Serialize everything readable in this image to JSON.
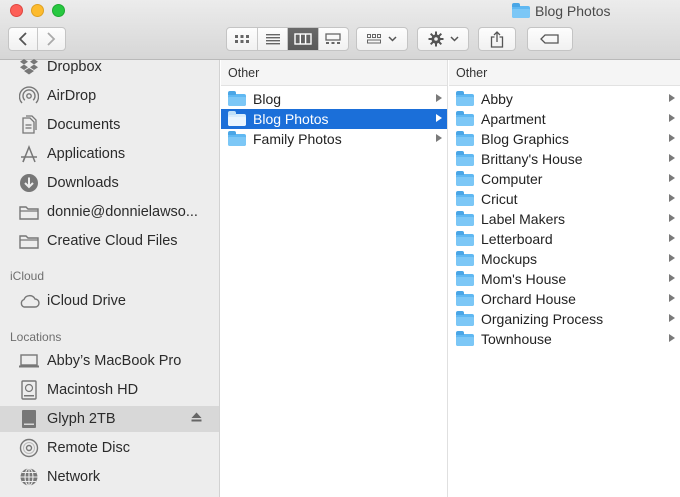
{
  "window": {
    "title": "Blog Photos"
  },
  "sidebar": {
    "items": [
      {
        "label": "Dropbox",
        "icon": "dropbox-icon"
      },
      {
        "label": "AirDrop",
        "icon": "airdrop-icon"
      },
      {
        "label": "Documents",
        "icon": "documents-icon"
      },
      {
        "label": "Applications",
        "icon": "applications-icon"
      },
      {
        "label": "Downloads",
        "icon": "downloads-icon"
      },
      {
        "label": "donnie@donnielawso...",
        "icon": "folder-icon"
      },
      {
        "label": "Creative Cloud Files",
        "icon": "folder-icon"
      }
    ],
    "icloud_header": "iCloud",
    "icloud_items": [
      {
        "label": "iCloud Drive",
        "icon": "cloud-icon"
      }
    ],
    "locations_header": "Locations",
    "location_items": [
      {
        "label": "Abby’s MacBook Pro",
        "icon": "laptop-icon"
      },
      {
        "label": "Macintosh HD",
        "icon": "harddisk-icon"
      },
      {
        "label": "Glyph 2TB",
        "icon": "external-disk-icon",
        "eject": true
      },
      {
        "label": "Remote Disc",
        "icon": "disc-icon"
      },
      {
        "label": "Network",
        "icon": "network-icon"
      }
    ]
  },
  "columns": [
    {
      "header": "Other",
      "items": [
        "Blog",
        "Blog Photos",
        "Family Photos"
      ],
      "selected": "Blog Photos"
    },
    {
      "header": "Other",
      "items": [
        "Abby",
        "Apartment",
        "Blog Graphics",
        "Brittany's House",
        "Computer",
        "Cricut",
        "Label Makers",
        "Letterboard",
        "Mockups",
        "Mom's House",
        "Orchard House",
        "Organizing Process",
        "Townhouse"
      ]
    }
  ],
  "colors": {
    "selection": "#1b6fd9",
    "folder": "#5fb8f2",
    "sidebar_bg": "#ededed"
  }
}
